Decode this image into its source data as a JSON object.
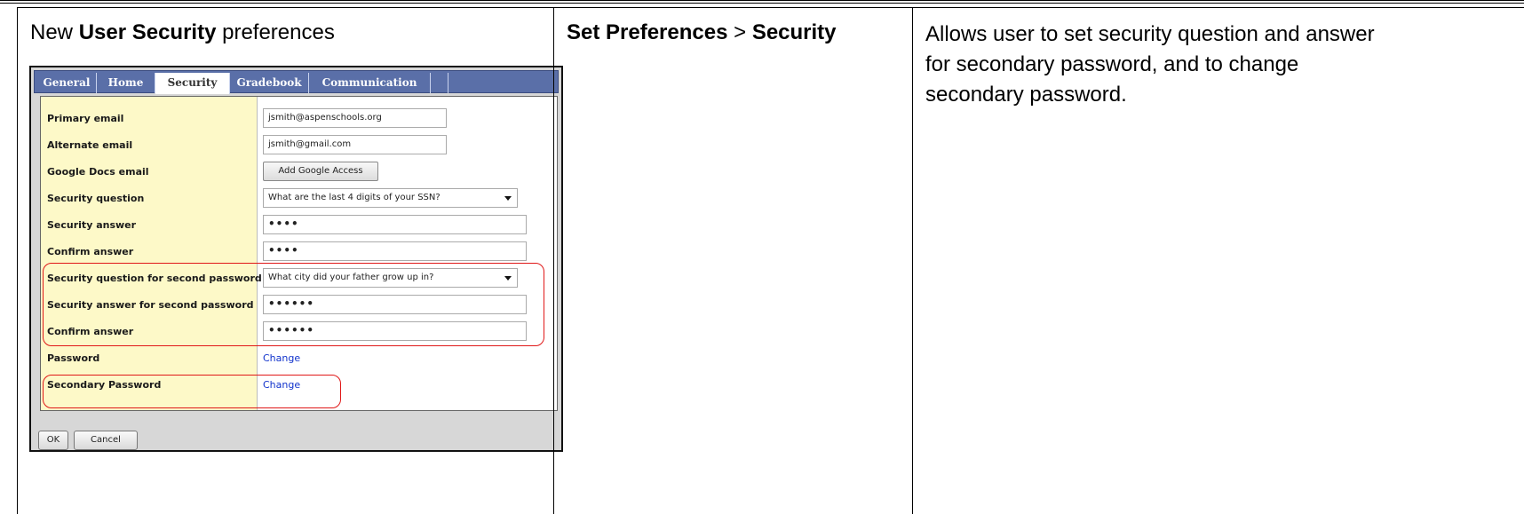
{
  "rows": [
    {
      "feature": {
        "prefix": "New ",
        "bold": "User Security",
        "suffix": " preferences"
      },
      "location": {
        "bold1": "Set Preferences",
        "sep": " > ",
        "bold2": "Security"
      },
      "description": "Allows user to set security question and answer for secondary password, and to change secondary password."
    }
  ],
  "dialog": {
    "tabs": [
      "General",
      "Home",
      "Security",
      "Gradebook",
      "Communication"
    ],
    "active_tab": "Security",
    "fields": {
      "primary_email": {
        "label": "Primary email",
        "value": "jsmith@aspenschools.org"
      },
      "alternate_email": {
        "label": "Alternate email",
        "value": "jsmith@gmail.com"
      },
      "google_docs": {
        "label": "Google Docs email",
        "button": "Add Google Access"
      },
      "security_question": {
        "label": "Security question",
        "value": "What are the last 4 digits of your SSN?"
      },
      "security_answer": {
        "label": "Security answer",
        "value": "••••"
      },
      "confirm_answer": {
        "label": "Confirm answer",
        "value": "••••"
      },
      "second_question": {
        "label": "Security question for second password",
        "value": "What city did your father grow up in?"
      },
      "second_answer": {
        "label": "Security answer for second password",
        "value": "••••••"
      },
      "second_confirm": {
        "label": "Confirm answer",
        "value": "••••••"
      },
      "password": {
        "label": "Password",
        "link": "Change"
      },
      "secondary_password": {
        "label": "Secondary Password",
        "link": "Change"
      }
    },
    "buttons": {
      "ok": "OK",
      "cancel": "Cancel"
    },
    "highlight_color": "#e01818"
  }
}
